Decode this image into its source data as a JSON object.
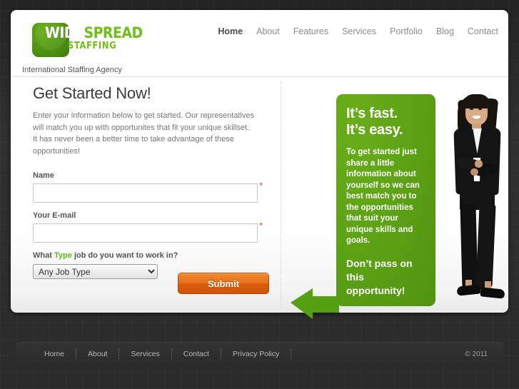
{
  "logo": {
    "word_one": "WIDE",
    "word_two": "SPREAD",
    "word_three": "STAFFING",
    "tagline": "International Staffing Agency",
    "brand_green": "#6fbf1b",
    "square_green": "#4e9310"
  },
  "nav": {
    "items": [
      {
        "label": "Home",
        "active": true
      },
      {
        "label": "About",
        "active": false
      },
      {
        "label": "Features",
        "active": false
      },
      {
        "label": "Services",
        "active": false
      },
      {
        "label": "Portfolio",
        "active": false
      },
      {
        "label": "Blog",
        "active": false
      },
      {
        "label": "Contact",
        "active": false
      }
    ]
  },
  "main": {
    "title": "Get Started Now!",
    "intro": "Enter your information below to get started. Our representatives will match you up with opportunites that fit your unique skillset. It has never been a better time to take advantage of these opportunities!"
  },
  "form": {
    "name_label": "Name",
    "name_value": "",
    "name_placeholder": "",
    "name_required_marker": "*",
    "email_label": "Your E-mail",
    "email_value": "",
    "email_placeholder": "",
    "email_required_marker": "*",
    "jobtype_question_before": "What ",
    "jobtype_question_highlight": "Type",
    "jobtype_question_after": " job do you want to work in?",
    "jobtype_selected": "Any Job Type",
    "jobtype_options": [
      "Any Job Type"
    ],
    "submit_label": "Submit",
    "submit_color": "#e8701a",
    "required_color": "#e23b2e"
  },
  "promo": {
    "headline_line1": "It’s fast.",
    "headline_line2": "It’s easy.",
    "body": "To get started just share a little information about yourself so we can best match you to the opportunities that suit your unique skills and goals.",
    "cta": "Don’t pass on this opportunity!",
    "background_color": "#5da315"
  },
  "hero_image": {
    "alt": "smiling businesswoman in black suit with arms crossed"
  },
  "footer": {
    "links": [
      "Home",
      "About",
      "Services",
      "Contact",
      "Privacy Policy"
    ],
    "copyright": "© 2011"
  }
}
